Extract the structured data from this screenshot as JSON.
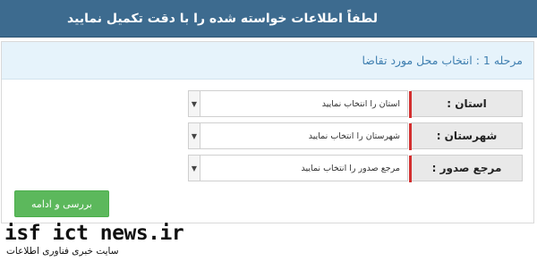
{
  "header": {
    "title": "لطفاً اطلاعات خواسته شده را با دقت تکمیل نمایید"
  },
  "panel": {
    "step_title": "مرحله 1 : انتخاب محل مورد تقاضا"
  },
  "form": {
    "rows": [
      {
        "label": "استان :",
        "value": "استان را انتخاب نمایید"
      },
      {
        "label": "شهرستان :",
        "value": "شهرستان را انتخاب نمایید"
      },
      {
        "label": "مرجع صدور :",
        "value": "مرجع صدور را انتخاب نمایید"
      }
    ],
    "submit_label": "بررسی و ادامه"
  },
  "watermark": {
    "site": "isf ict news.ir",
    "caption": "سایت خبری  فناوری اطلاعات"
  },
  "colors": {
    "header": "#3d6b8f",
    "accent": "#d32f2f",
    "button": "#5cb85c",
    "step_title": "#3f7fb0"
  },
  "icons": {
    "select_arrow": "chevron-down-icon"
  }
}
